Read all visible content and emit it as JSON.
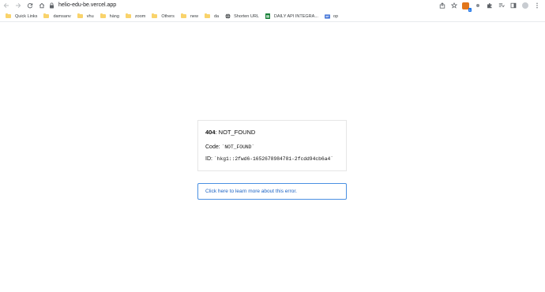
{
  "browser": {
    "url": "helio-edu-be.vercel.app",
    "bookmarks": [
      {
        "label": "Quick Links",
        "icon": "folder-icon"
      },
      {
        "label": "damsanv",
        "icon": "folder-icon"
      },
      {
        "label": "vhu",
        "icon": "folder-icon"
      },
      {
        "label": "hàng",
        "icon": "folder-icon"
      },
      {
        "label": "zoom",
        "icon": "folder-icon"
      },
      {
        "label": "Others",
        "icon": "folder-icon"
      },
      {
        "label": "new",
        "icon": "folder-icon"
      },
      {
        "label": "da",
        "icon": "folder-icon"
      },
      {
        "label": "Shorten URL",
        "icon": "globe-icon"
      },
      {
        "label": "DAILY API INTEGRA...",
        "icon": "sheets-icon"
      },
      {
        "label": "op",
        "icon": "docs-icon"
      }
    ],
    "extension_badge": "1"
  },
  "error": {
    "code_number": "404",
    "title_suffix": ": NOT_FOUND",
    "code_label": "Code: ",
    "code_value": "`NOT_FOUND`",
    "id_label": "ID: ",
    "id_value": "`hkg1::2fwd6-1652678984781-2fcdd94cb6a4`",
    "help_link": "Click here to learn more about this error."
  },
  "colors": {
    "link": "#1a62c4",
    "link_border": "#4a90e2",
    "folder": "#f9d36b"
  }
}
